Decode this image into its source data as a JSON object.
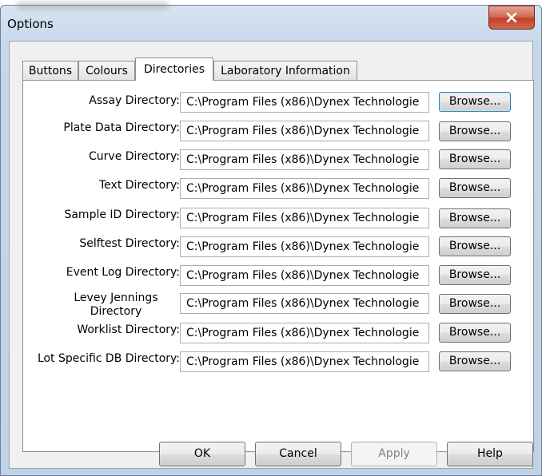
{
  "window": {
    "title": "Options",
    "close_glyph": "close-icon"
  },
  "tabs": [
    {
      "label": "Buttons",
      "active": false
    },
    {
      "label": "Colours",
      "active": false
    },
    {
      "label": "Directories",
      "active": true
    },
    {
      "label": "Laboratory Information",
      "active": false
    }
  ],
  "directories": [
    {
      "label": "Assay Directory:",
      "value": "C:\\Program Files (x86)\\Dynex Technologie",
      "button": "Browse...",
      "focused": true
    },
    {
      "label": "Plate Data Directory:",
      "value": "C:\\Program Files (x86)\\Dynex Technologie",
      "button": "Browse..."
    },
    {
      "label": "Curve Directory:",
      "value": "C:\\Program Files (x86)\\Dynex Technologie",
      "button": "Browse..."
    },
    {
      "label": "Text Directory:",
      "value": "C:\\Program Files (x86)\\Dynex Technologie",
      "button": "Browse..."
    },
    {
      "label": "Sample ID Directory:",
      "value": "C:\\Program Files (x86)\\Dynex Technologie",
      "button": "Browse..."
    },
    {
      "label": "Selftest Directory:",
      "value": "C:\\Program Files (x86)\\Dynex Technologie",
      "button": "Browse..."
    },
    {
      "label": "Event Log Directory:",
      "value": "C:\\Program Files (x86)\\Dynex Technologie",
      "button": "Browse..."
    },
    {
      "label": "Levey Jennings Directory",
      "value": "C:\\Program Files (x86)\\Dynex Technologie",
      "button": "Browse..."
    },
    {
      "label": "Worklist Directory:",
      "value": "C:\\Program Files (x86)\\Dynex Technologie",
      "button": "Browse..."
    },
    {
      "label": "Lot Specific DB Directory:",
      "value": "C:\\Program Files (x86)\\Dynex Technologie",
      "button": "Browse..."
    }
  ],
  "buttons": {
    "ok": "OK",
    "cancel": "Cancel",
    "apply": "Apply",
    "help": "Help"
  },
  "colors": {
    "close_button": "#c2402a",
    "window_frame": "#bfd2e7",
    "focus_border": "#3c7fb1"
  }
}
